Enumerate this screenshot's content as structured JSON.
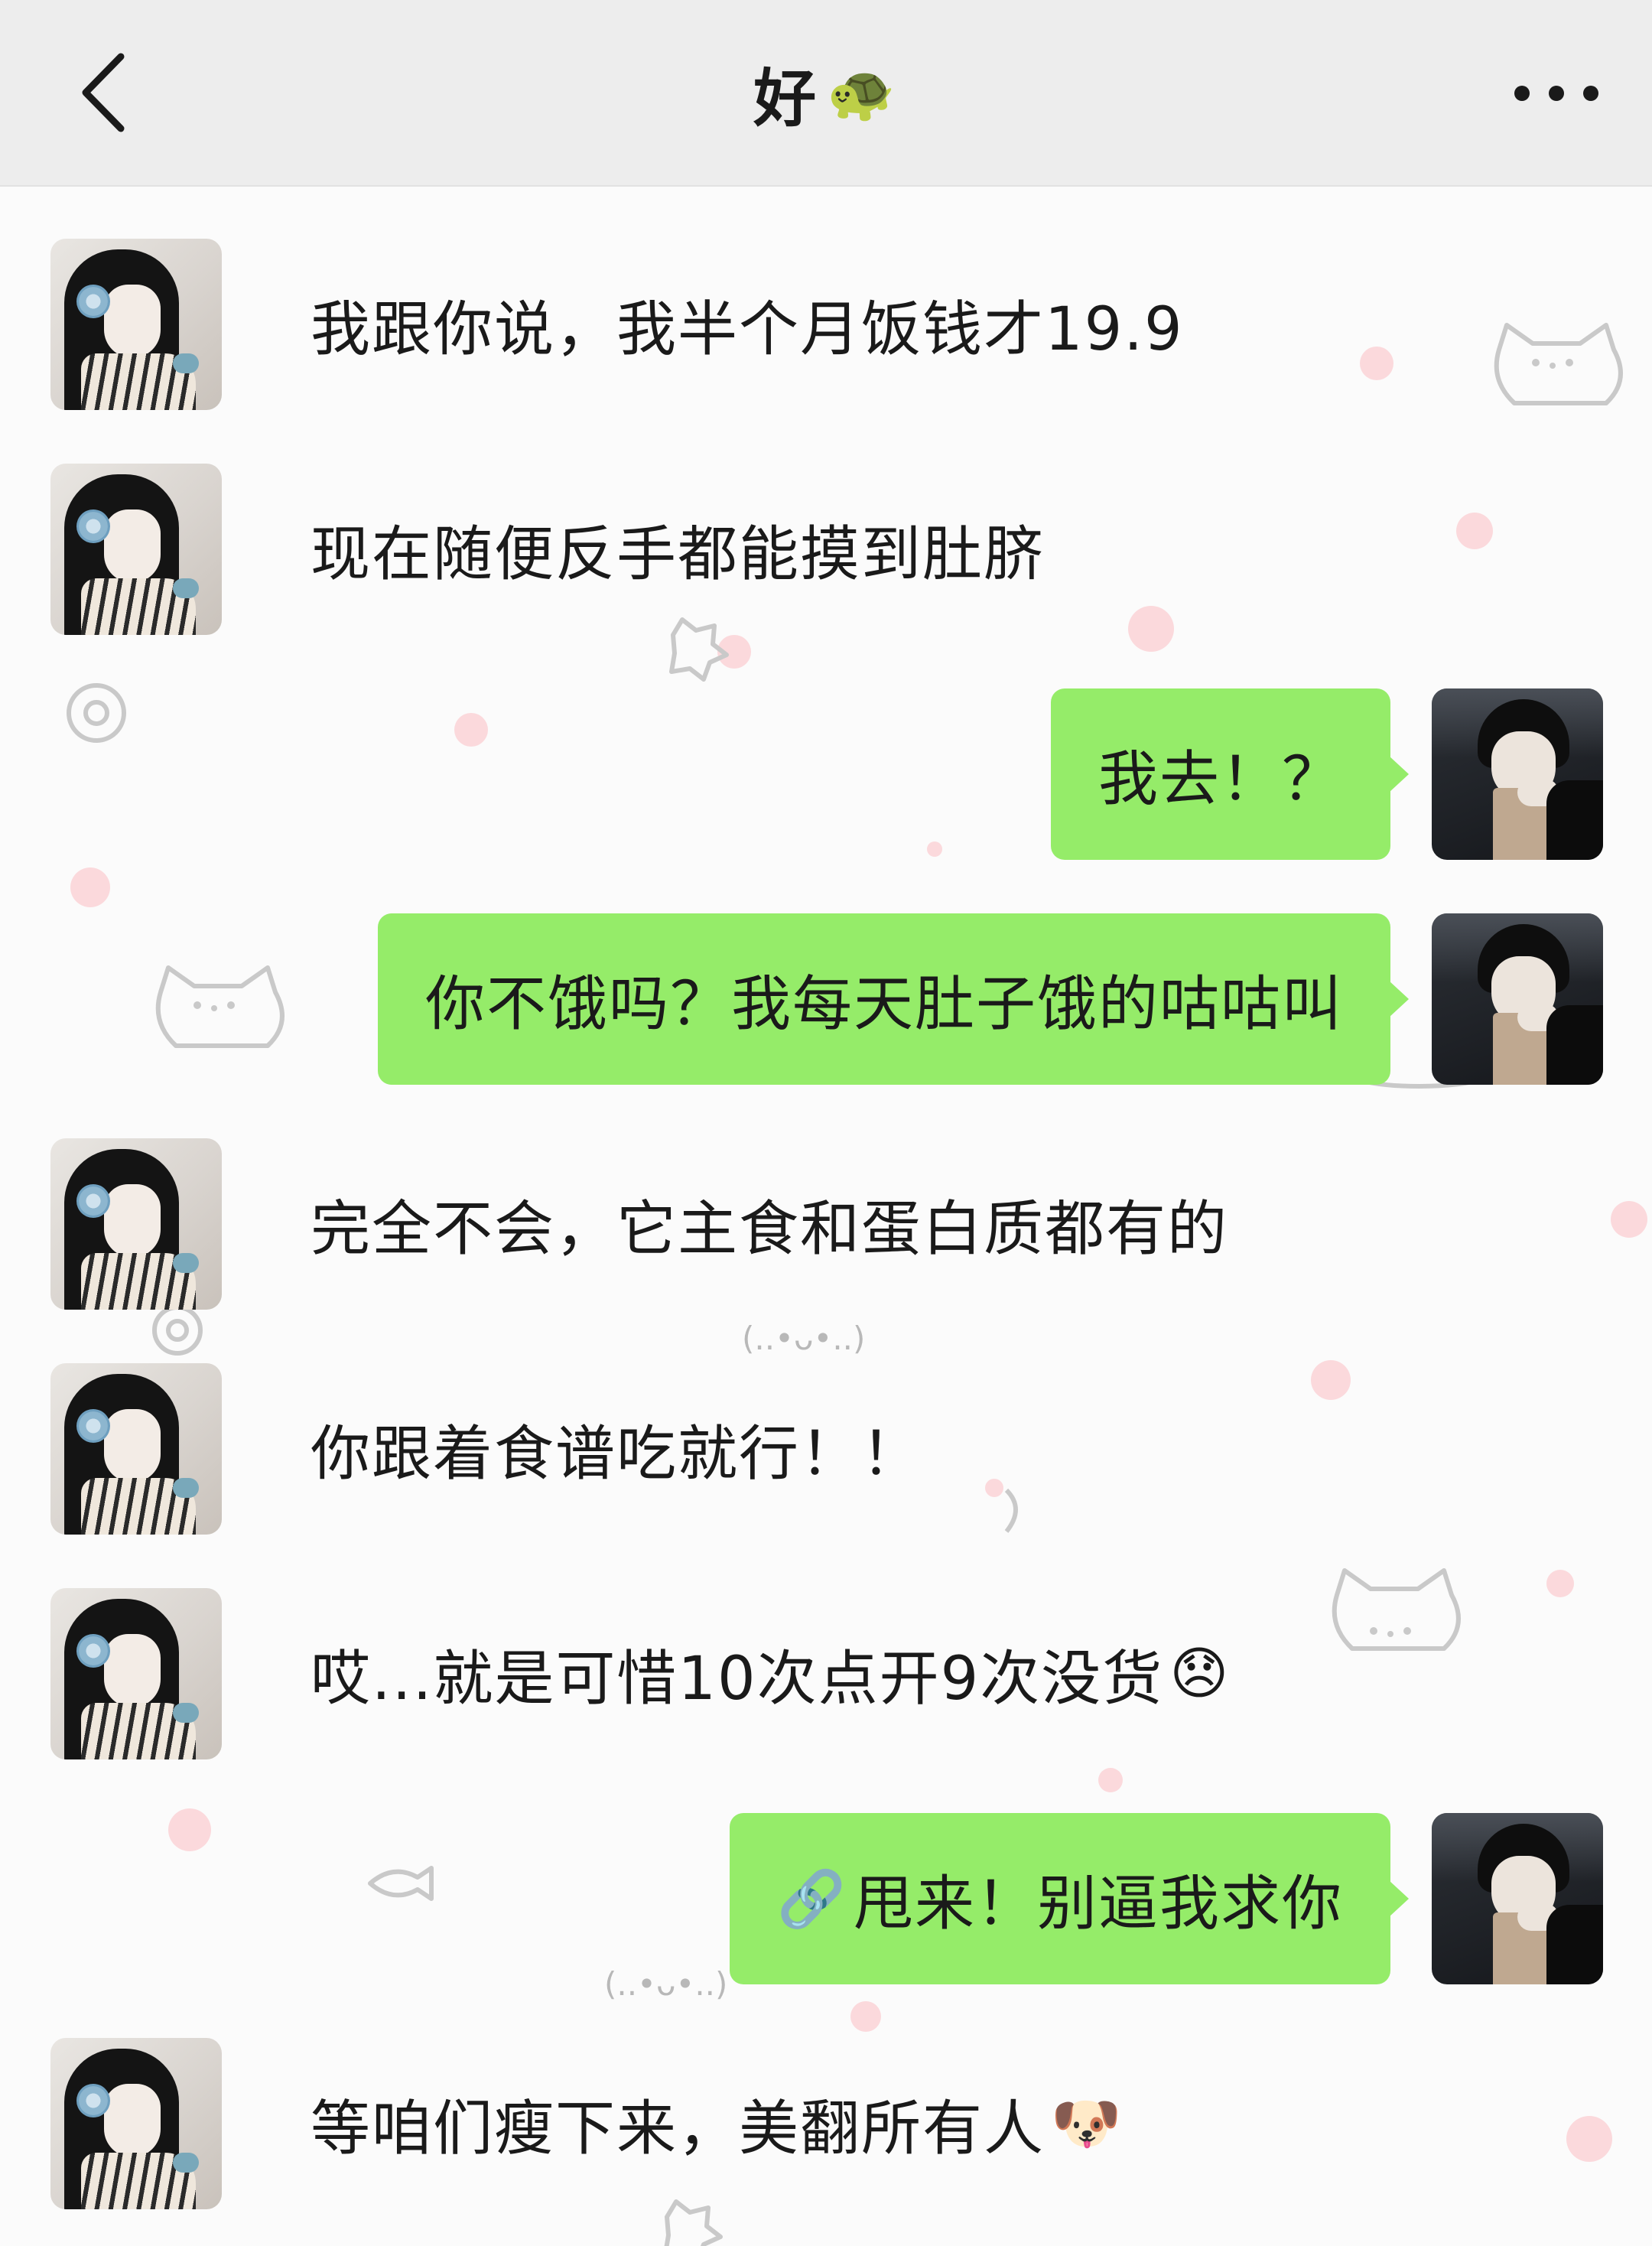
{
  "header": {
    "title": "好",
    "title_emoji": "🐢",
    "back_icon": "chevron-left-icon",
    "more_icon": "more-dots-icon"
  },
  "messages": [
    {
      "side": "left",
      "text": "我跟你说，我半个月饭钱才19.9"
    },
    {
      "side": "left",
      "text": "现在随便反手都能摸到肚脐"
    },
    {
      "side": "right",
      "text": "我去！？"
    },
    {
      "side": "right",
      "text": "你不饿吗？我每天肚子饿的咕咕叫"
    },
    {
      "side": "left",
      "text": "完全不会，它主食和蛋白质都有的"
    },
    {
      "side": "left",
      "text": "你跟着食谱吃就行！！"
    },
    {
      "side": "left",
      "text": "哎...就是可惜10次点开9次没货",
      "emoji": "😞"
    },
    {
      "side": "right",
      "text": "甩来！别逼我求你",
      "lead_emoji": "🔗"
    },
    {
      "side": "left",
      "text": "等咱们瘦下来，美翻所有人",
      "emoji": "🐶"
    }
  ],
  "kaomoji": [
    "(..•ᴗ•..)",
    "(..•ᴗ•..)"
  ],
  "colors": {
    "header_bg": "#ededed",
    "bubble_green": "#95ec69",
    "background": "#fbfbfb"
  }
}
